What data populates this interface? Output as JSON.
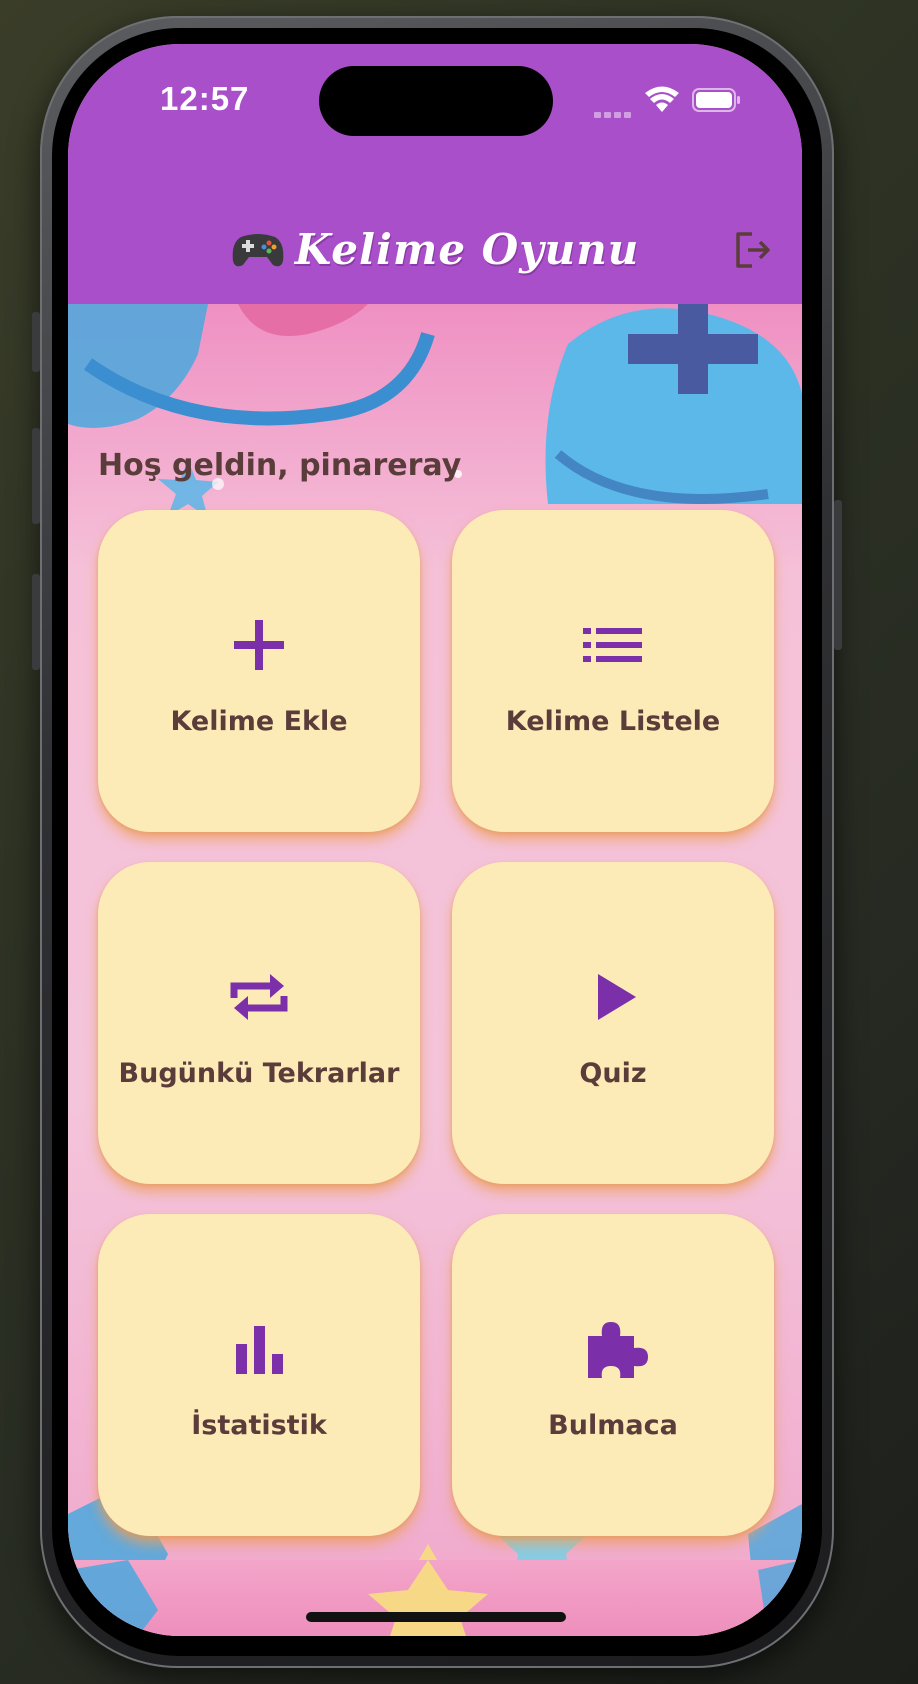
{
  "status_bar": {
    "time": "12:57"
  },
  "app_bar": {
    "title": "Kelime Oyunu",
    "title_icon": "gamepad-icon",
    "logout_icon": "logout-icon"
  },
  "greeting": "Hoş geldin, pinareray",
  "menu": [
    {
      "label": "Kelime Ekle",
      "icon": "plus-icon"
    },
    {
      "label": "Kelime Listele",
      "icon": "list-icon"
    },
    {
      "label": "Bugünkü Tekrarlar",
      "icon": "repeat-icon"
    },
    {
      "label": "Quiz",
      "icon": "play-icon"
    },
    {
      "label": "İstatistik",
      "icon": "bar-chart-icon"
    },
    {
      "label": "Bulmaca",
      "icon": "puzzle-icon"
    }
  ],
  "colors": {
    "app_bar": "#a94fc9",
    "tile_bg": "#fdebb7",
    "tile_icon": "#7b2fa8",
    "tile_text": "#5a3d3b"
  }
}
